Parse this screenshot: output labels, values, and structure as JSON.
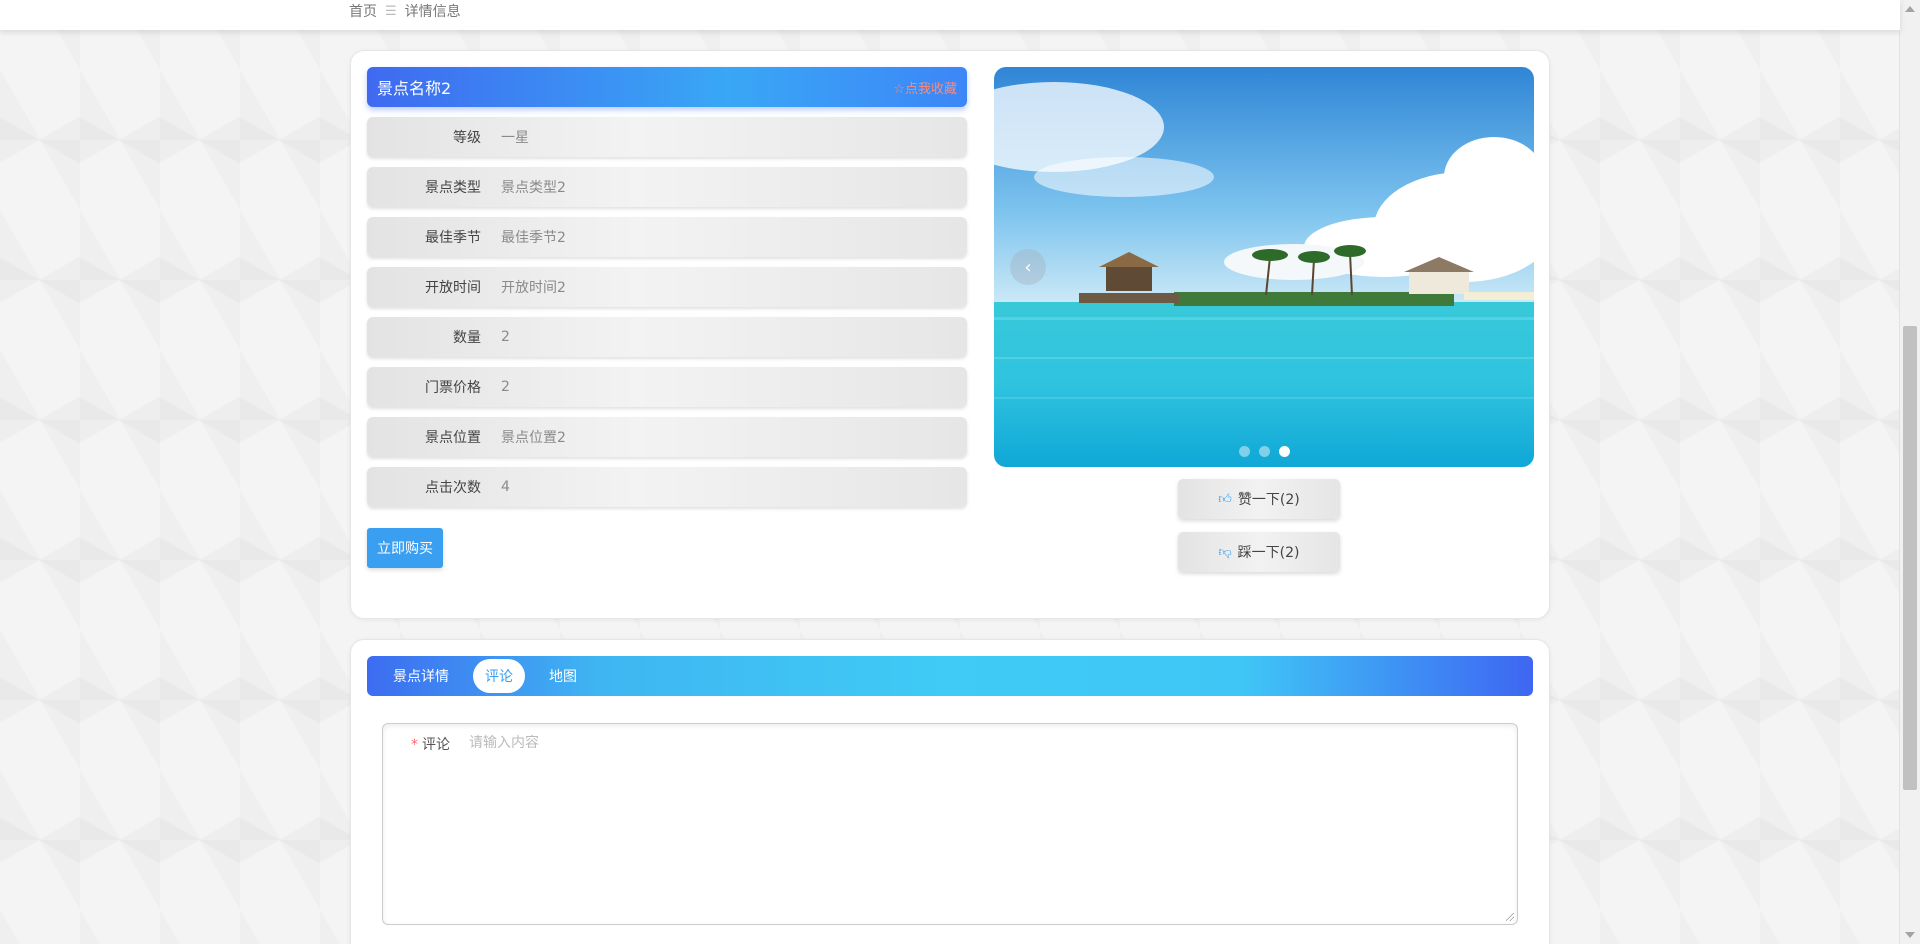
{
  "breadcrumb": {
    "home": "首页",
    "separator": "☰",
    "current": "详情信息"
  },
  "detail": {
    "title": "景点名称2",
    "favorite_label": "☆点我收藏",
    "rows": [
      {
        "label": "等级",
        "value": "一星"
      },
      {
        "label": "景点类型",
        "value": "景点类型2"
      },
      {
        "label": "最佳季节",
        "value": "最佳季节2"
      },
      {
        "label": "开放时间",
        "value": "开放时间2"
      },
      {
        "label": "数量",
        "value": "2"
      },
      {
        "label": "门票价格",
        "value": "2"
      },
      {
        "label": "景点位置",
        "value": "景点位置2"
      },
      {
        "label": "点击次数",
        "value": "4"
      }
    ],
    "buy_label": "立即购买"
  },
  "carousel": {
    "prev": "‹",
    "next": "›",
    "slide_count": 3,
    "active_index": 2
  },
  "votes": {
    "like_label": "赞一下(2)",
    "dislike_label": "踩一下(2)"
  },
  "tabs": [
    {
      "label": "景点详情",
      "active": false
    },
    {
      "label": "评论",
      "active": true
    },
    {
      "label": "地图",
      "active": false
    }
  ],
  "comment": {
    "label": "评论",
    "required_mark": "*",
    "placeholder": "请输入内容",
    "value": ""
  },
  "colors": {
    "accent": "#3a9ff0",
    "favorite": "#ff8a73",
    "required": "#f56c6c"
  }
}
